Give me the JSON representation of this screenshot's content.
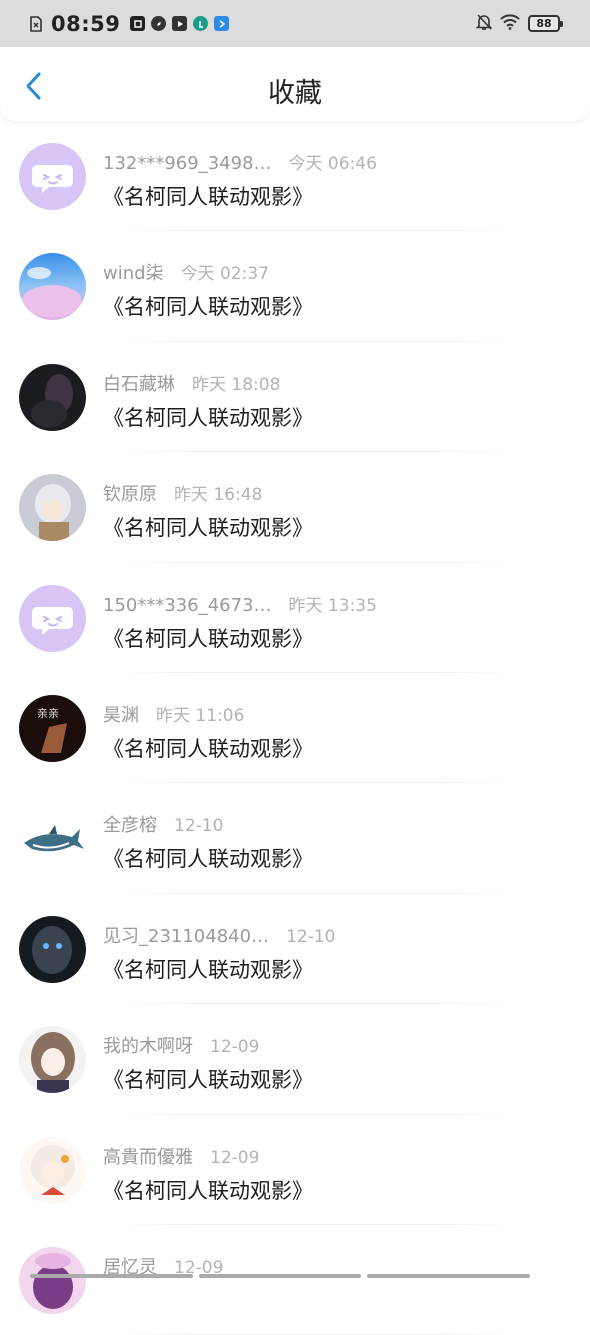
{
  "status_bar": {
    "time": "08:59",
    "battery": "88"
  },
  "header": {
    "title": "收藏"
  },
  "items": [
    {
      "name": "132***969_3498…",
      "time": "今天 06:46",
      "title": "《名柯同人联动观影》",
      "avatar": "default-bot"
    },
    {
      "name": "wind柒",
      "time": "今天 02:37",
      "title": "《名柯同人联动观影》",
      "avatar": "sky-flower"
    },
    {
      "name": "白石藏琳",
      "time": "昨天 18:08",
      "title": "《名柯同人联动观影》",
      "avatar": "dark-figure"
    },
    {
      "name": "钦原原",
      "time": "昨天 16:48",
      "title": "《名柯同人联动观影》",
      "avatar": "anime-silver"
    },
    {
      "name": "150***336_4673…",
      "time": "昨天 13:35",
      "title": "《名柯同人联动观影》",
      "avatar": "default-bot"
    },
    {
      "name": "昊渊",
      "time": "昨天 11:06",
      "title": "《名柯同人联动观影》",
      "avatar": "dark-red"
    },
    {
      "name": "全彦榕",
      "time": "12-10",
      "title": "《名柯同人联动观影》",
      "avatar": "shark"
    },
    {
      "name": "见习_231104840…",
      "time": "12-10",
      "title": "《名柯同人联动观影》",
      "avatar": "dark-blue-eyes"
    },
    {
      "name": "我的木啊呀",
      "time": "12-09",
      "title": "《名柯同人联动观影》",
      "avatar": "anime-girl"
    },
    {
      "name": "高貴而優雅",
      "time": "12-09",
      "title": "《名柯同人联动观影》",
      "avatar": "anime-white"
    },
    {
      "name": "居忆灵",
      "time": "12-09",
      "title": "",
      "avatar": "anime-pink"
    }
  ]
}
